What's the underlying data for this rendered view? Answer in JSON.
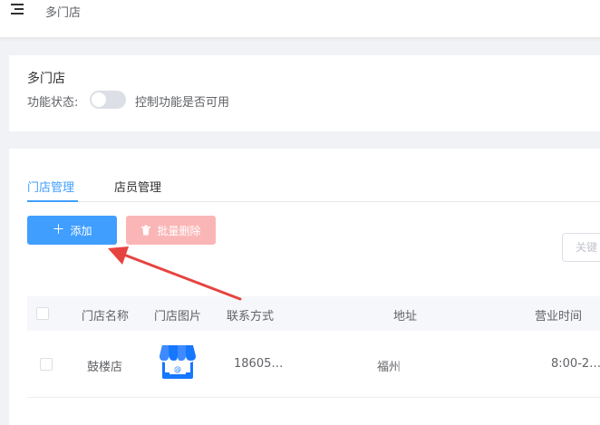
{
  "header": {
    "title": "多门店",
    "menu_icon": "menu-fold-icon"
  },
  "feature": {
    "title": "多门店",
    "status_label": "功能状态:",
    "switch_on": false,
    "description": "控制功能是否可用"
  },
  "tabs": [
    {
      "label": "门店管理",
      "active": true
    },
    {
      "label": "店员管理",
      "active": false
    }
  ],
  "toolbar": {
    "add_label": "添加",
    "add_icon": "plus-icon",
    "batch_delete_label": "批量删除",
    "batch_delete_icon": "trash-icon",
    "search_placeholder": "关键"
  },
  "table": {
    "columns": [
      "门店名称",
      "门店图片",
      "联系方式",
      "地址",
      "营业时间"
    ],
    "rows": [
      {
        "name": "鼓楼店",
        "image_icon": "store-icon",
        "contact": "18605…",
        "address": "福州",
        "hours": "8:00-2…"
      }
    ]
  },
  "annotation": {
    "arrow_color": "#e64340"
  },
  "colors": {
    "primary": "#409eff",
    "danger_disabled": "#fab6b6",
    "store_icon": "#1677ff"
  }
}
